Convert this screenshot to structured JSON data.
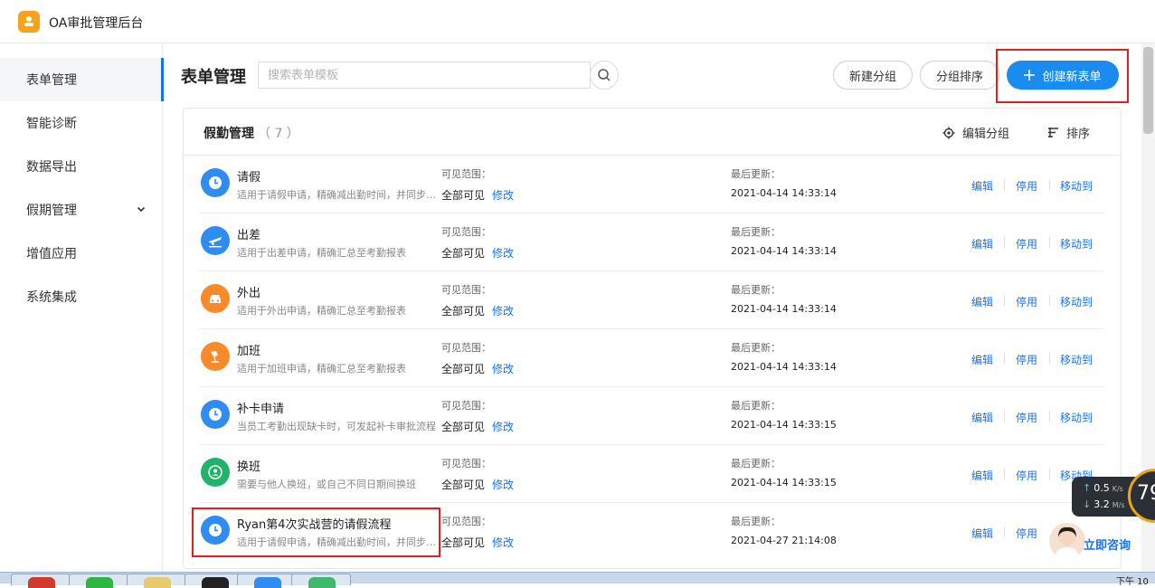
{
  "app": {
    "title": "OA审批管理后台"
  },
  "sidebar": {
    "items": [
      {
        "label": "表单管理",
        "active": true
      },
      {
        "label": "智能诊断"
      },
      {
        "label": "数据导出"
      },
      {
        "label": "假期管理",
        "has_children": true
      },
      {
        "label": "增值应用"
      },
      {
        "label": "系统集成"
      }
    ]
  },
  "header": {
    "title": "表单管理",
    "search_placeholder": "搜索表单模板",
    "new_group": "新建分组",
    "group_sort": "分组排序",
    "create_form": "创建新表单"
  },
  "group": {
    "name": "假勤管理",
    "count": "（ 7 ）",
    "edit_group": "编辑分组",
    "sort": "排序"
  },
  "labels": {
    "visible_range": "可见范围：",
    "last_updated": "最后更新：",
    "modify": "修改",
    "edit": "编辑",
    "disable": "停用",
    "move_to": "移动到"
  },
  "forms": [
    {
      "name": "请假",
      "desc": "适用于请假申请，精确减出勤时间，并同步至考勤报表",
      "visible": "全部可见",
      "updated": "2021-04-14 14:33:14",
      "icon": "clock-icon",
      "color": "#2f8cf0"
    },
    {
      "name": "出差",
      "desc": "适用于出差申请，精确汇总至考勤报表",
      "visible": "全部可见",
      "updated": "2021-04-14 14:33:14",
      "icon": "plane-icon",
      "color": "#2f8cf0"
    },
    {
      "name": "外出",
      "desc": "适用于外出申请，精确汇总至考勤报表",
      "visible": "全部可见",
      "updated": "2021-04-14 14:33:14",
      "icon": "car-icon",
      "color": "#f78a2a"
    },
    {
      "name": "加班",
      "desc": "适用于加班申请，精确汇总至考勤报表",
      "visible": "全部可见",
      "updated": "2021-04-14 14:33:14",
      "icon": "lamp-icon",
      "color": "#f78a2a"
    },
    {
      "name": "补卡申请",
      "desc": "当员工考勤出现缺卡时，可发起补卡审批流程",
      "visible": "全部可见",
      "updated": "2021-04-14 14:33:15",
      "icon": "clock-icon",
      "color": "#2f8cf0"
    },
    {
      "name": "换班",
      "desc": "需要与他人换班，或自己不同日期间换班",
      "visible": "全部可见",
      "updated": "2021-04-14 14:33:15",
      "icon": "swap-person-icon",
      "color": "#22b36a"
    },
    {
      "name": "Ryan第4次实战营的请假流程",
      "desc": "适用于请假申请，精确减出勤时间，并同步至考勤报表",
      "visible": "全部可见",
      "updated": "2021-04-27 21:14:08",
      "icon": "clock-icon",
      "color": "#2f8cf0"
    }
  ],
  "overlay": {
    "upload_speed": "0.5",
    "upload_unit": "K/s",
    "download_speed": "3.2",
    "download_unit": "M/s",
    "percent": "79",
    "consult": "立即咨询"
  },
  "taskbar": {
    "time": "下午 10"
  }
}
